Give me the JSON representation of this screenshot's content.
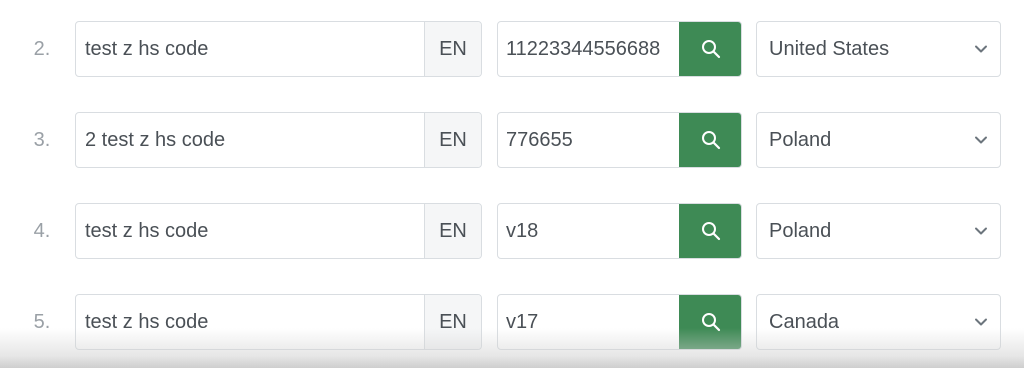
{
  "rows": [
    {
      "number": "2.",
      "description": "test z hs code",
      "language": "EN",
      "code": "11223344556688",
      "country": "United States"
    },
    {
      "number": "3.",
      "description": "2 test z hs code",
      "language": "EN",
      "code": "776655",
      "country": "Poland"
    },
    {
      "number": "4.",
      "description": "test z hs code",
      "language": "EN",
      "code": "v18",
      "country": "Poland"
    },
    {
      "number": "5.",
      "description": "test z hs code",
      "language": "EN",
      "code": "v17",
      "country": "Canada"
    }
  ],
  "icons": {
    "search": "search-icon",
    "dropdown": "chevron-down-icon"
  },
  "colors": {
    "search_button": "#3e8a55",
    "border": "#d9dde1",
    "addon_background": "#f5f6f7",
    "row_number": "#9aa0a6",
    "text": "#4a5056"
  }
}
